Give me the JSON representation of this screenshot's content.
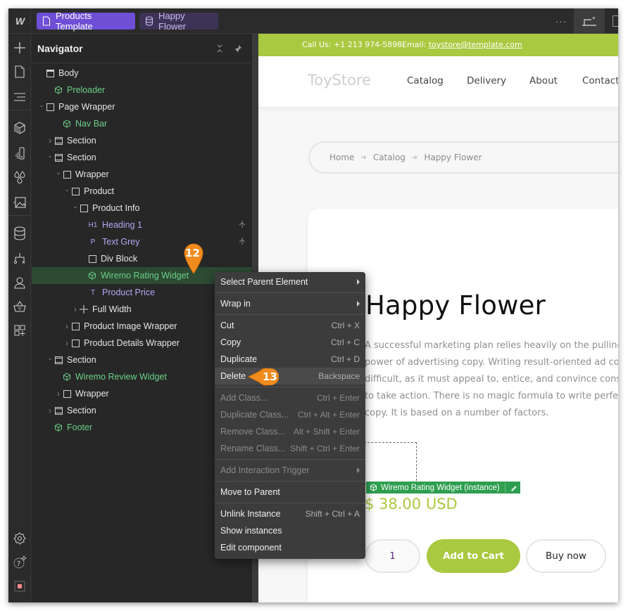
{
  "topbar": {
    "logo": "W",
    "tabs": [
      {
        "label": "Products Template",
        "icon": "page-icon"
      },
      {
        "label": "Happy Flower",
        "icon": "database-icon"
      }
    ],
    "more_label": "···"
  },
  "rail": {
    "icons": [
      "add-icon",
      "pages-icon",
      "navigator-icon",
      "components-icon",
      "styles-icon",
      "variables-icon",
      "assets-icon",
      "cms-icon",
      "logic-icon",
      "users-icon",
      "ecommerce-icon",
      "apps-icon",
      "settings-icon",
      "help-icon",
      "status-icon"
    ]
  },
  "navigator": {
    "title": "Navigator",
    "tree": [
      {
        "label": "Body",
        "type": "body",
        "depth": 0,
        "caret": ""
      },
      {
        "label": "Preloader",
        "type": "component",
        "depth": 1,
        "caret": ""
      },
      {
        "label": "Page Wrapper",
        "type": "box",
        "depth": 0,
        "caret": "open"
      },
      {
        "label": "Nav Bar",
        "type": "component",
        "depth": 2,
        "caret": ""
      },
      {
        "label": "Section",
        "type": "section",
        "depth": 1,
        "caret": "closed"
      },
      {
        "label": "Section",
        "type": "section",
        "depth": 1,
        "caret": "open"
      },
      {
        "label": "Wrapper",
        "type": "box",
        "depth": 2,
        "caret": "open"
      },
      {
        "label": "Product",
        "type": "box",
        "depth": 3,
        "caret": "open"
      },
      {
        "label": "Product Info",
        "type": "box",
        "depth": 4,
        "caret": "open"
      },
      {
        "label": "Heading 1",
        "type": "heading",
        "tag": "H1",
        "depth": 5,
        "caret": "",
        "bound": true
      },
      {
        "label": "Text Grey",
        "type": "paragraph",
        "tag": "P",
        "depth": 5,
        "caret": "",
        "bound": true
      },
      {
        "label": "Div Block",
        "type": "box",
        "depth": 5,
        "caret": ""
      },
      {
        "label": "Wiremo Rating Widget",
        "type": "component",
        "depth": 5,
        "caret": "",
        "selected": true
      },
      {
        "label": "Product Price",
        "type": "text",
        "tag": "T",
        "depth": 5,
        "caret": ""
      },
      {
        "label": "Full Width",
        "type": "plus",
        "depth": 4,
        "caret": "closed"
      },
      {
        "label": "Product Image Wrapper",
        "type": "box",
        "depth": 3,
        "caret": "closed"
      },
      {
        "label": "Product Details Wrapper",
        "type": "box",
        "depth": 3,
        "caret": "closed"
      },
      {
        "label": "Section",
        "type": "section",
        "depth": 1,
        "caret": "open"
      },
      {
        "label": "Wiremo Review Widget",
        "type": "component",
        "depth": 2,
        "caret": ""
      },
      {
        "label": "Wrapper",
        "type": "box",
        "depth": 2,
        "caret": "closed"
      },
      {
        "label": "Section",
        "type": "section",
        "depth": 1,
        "caret": "closed"
      },
      {
        "label": "Footer",
        "type": "component",
        "depth": 1,
        "caret": ""
      }
    ]
  },
  "context_menu": {
    "items": [
      {
        "label": "Select Parent Element",
        "shortcut": "",
        "submenu": true,
        "disabled": false
      },
      {
        "sep": true
      },
      {
        "label": "Wrap in",
        "shortcut": "",
        "submenu": true,
        "disabled": false
      },
      {
        "sep": true
      },
      {
        "label": "Cut",
        "shortcut": "Ctrl + X",
        "disabled": false
      },
      {
        "label": "Copy",
        "shortcut": "Ctrl + C",
        "disabled": false
      },
      {
        "label": "Duplicate",
        "shortcut": "Ctrl + D",
        "disabled": false
      },
      {
        "label": "Delete",
        "shortcut": "Backspace",
        "disabled": false,
        "highlighted": true
      },
      {
        "sep": true
      },
      {
        "label": "Add Class...",
        "shortcut": "Ctrl + Enter",
        "disabled": true
      },
      {
        "label": "Duplicate Class...",
        "shortcut": "Ctrl + Alt + Enter",
        "disabled": true
      },
      {
        "label": "Remove Class...",
        "shortcut": "Alt + Shift + Enter",
        "disabled": true
      },
      {
        "label": "Rename Class...",
        "shortcut": "Shift + Ctrl + Enter",
        "disabled": true
      },
      {
        "sep": true
      },
      {
        "label": "Add Interaction Trigger",
        "shortcut": "",
        "submenu": true,
        "disabled": true
      },
      {
        "sep": true
      },
      {
        "label": "Move to Parent",
        "shortcut": "",
        "disabled": false
      },
      {
        "sep": true
      },
      {
        "label": "Unlink Instance",
        "shortcut": "Shift + Ctrl + A",
        "disabled": false
      },
      {
        "label": "Show instances",
        "shortcut": "",
        "disabled": false
      },
      {
        "label": "Edit component",
        "shortcut": "",
        "disabled": false
      }
    ]
  },
  "callouts": {
    "step_a": "12",
    "step_b": "13",
    "color": "#f08c1e"
  },
  "site": {
    "call": "Call Us: +1 213 974-5898",
    "email_label": "Email:",
    "email": "toystore@template.com",
    "brand": "ToyStore",
    "menu": [
      "Catalog",
      "Delivery",
      "About",
      "Contact"
    ],
    "breadcrumb": [
      "Home",
      "Catalog",
      "Happy Flower"
    ],
    "breadcrumb_sep": "➜",
    "product_title": "Happy Flower",
    "description_lines": [
      "A successful marketing plan relies heavily on the pulling",
      "power of advertising copy. Writing result-oriented ad copy is",
      "difficult, as it must appeal to, entice, and convince consumers",
      "to take action. There is no magic formula to write perfect ad",
      "copy. It is based on a number of factors."
    ],
    "widget_label": "Wiremo Rating Widget (instance)",
    "price": "$ 38.00 USD",
    "quantity": "1",
    "add_to_cart": "Add to Cart",
    "buy_now": "Buy now",
    "accent": "#a9c940"
  }
}
